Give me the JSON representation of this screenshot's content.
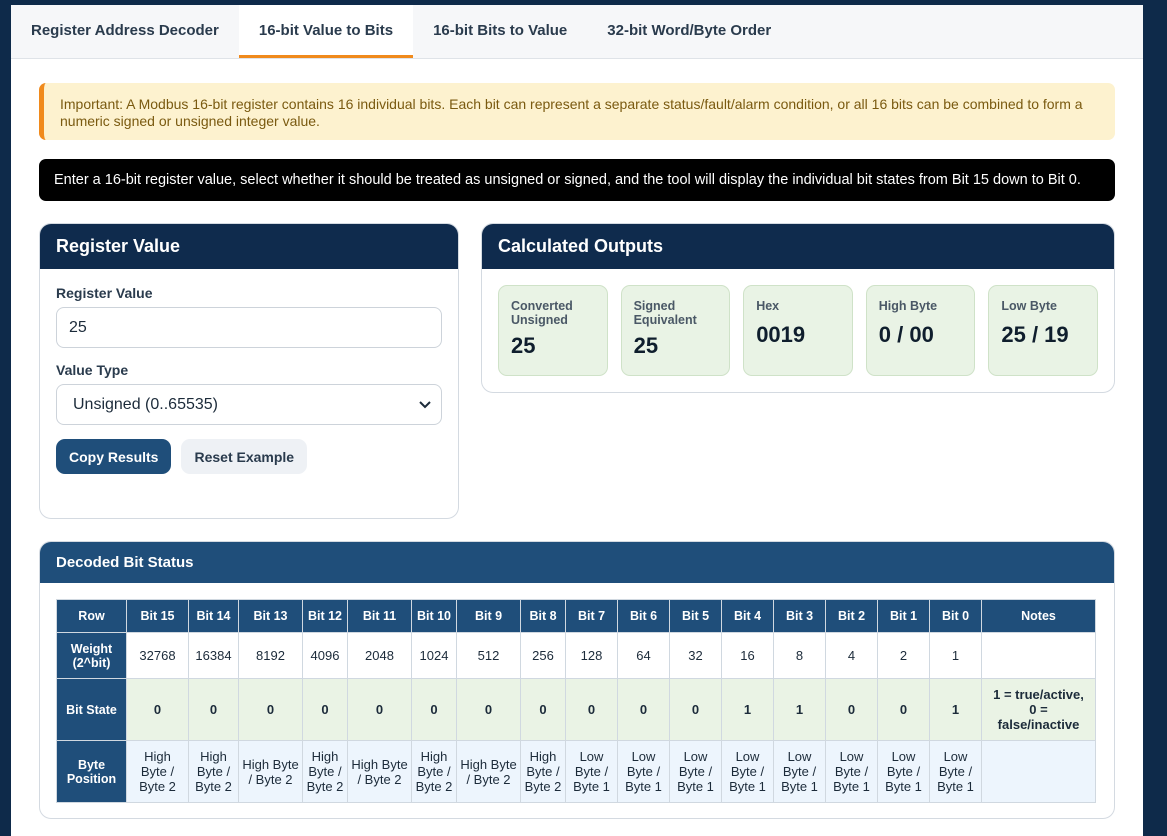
{
  "tabs": [
    {
      "label": "Register Address Decoder",
      "active": false
    },
    {
      "label": "16-bit Value to Bits",
      "active": true
    },
    {
      "label": "16-bit Bits to Value",
      "active": false
    },
    {
      "label": "32-bit Word/Byte Order",
      "active": false
    }
  ],
  "notice": "Important: A Modbus 16-bit register contains 16 individual bits. Each bit can represent a separate status/fault/alarm condition, or all 16 bits can be combined to form a numeric signed or unsigned integer value.",
  "instructions": "Enter a 16-bit register value, select whether it should be treated as unsigned or signed, and the tool will display the individual bit states from Bit 15 down to Bit 0.",
  "register_card": {
    "title": "Register Value",
    "value_label": "Register Value",
    "value": "25",
    "type_label": "Value Type",
    "type_selected": "Unsigned (0..65535)",
    "copy_button": "Copy Results",
    "reset_button": "Reset Example"
  },
  "outputs_card": {
    "title": "Calculated Outputs",
    "items": [
      {
        "label": "Converted Unsigned",
        "value": "25"
      },
      {
        "label": "Signed Equivalent",
        "value": "25"
      },
      {
        "label": "Hex",
        "value": "0019"
      },
      {
        "label": "High Byte",
        "value": "0 / 00"
      },
      {
        "label": "Low Byte",
        "value": "25 / 19"
      }
    ]
  },
  "bits_card": {
    "title": "Decoded Bit Status",
    "headers": [
      "Row",
      "Bit 15",
      "Bit 14",
      "Bit 13",
      "Bit 12",
      "Bit 11",
      "Bit 10",
      "Bit 9",
      "Bit 8",
      "Bit 7",
      "Bit 6",
      "Bit 5",
      "Bit 4",
      "Bit 3",
      "Bit 2",
      "Bit 1",
      "Bit 0",
      "Notes"
    ],
    "rows": [
      {
        "label": "Weight (2^bit)",
        "cls": "weight",
        "cells": [
          "32768",
          "16384",
          "8192",
          "4096",
          "2048",
          "1024",
          "512",
          "256",
          "128",
          "64",
          "32",
          "16",
          "8",
          "4",
          "2",
          "1"
        ],
        "note": ""
      },
      {
        "label": "Bit State",
        "cls": "state",
        "cells": [
          "0",
          "0",
          "0",
          "0",
          "0",
          "0",
          "0",
          "0",
          "0",
          "0",
          "0",
          "1",
          "1",
          "0",
          "0",
          "1"
        ],
        "note": "1 = true/active, 0 = false/inactive"
      },
      {
        "label": "Byte Position",
        "cls": "byte",
        "cells": [
          "High Byte / Byte 2",
          "High Byte / Byte 2",
          "High Byte / Byte 2",
          "High Byte / Byte 2",
          "High Byte / Byte 2",
          "High Byte / Byte 2",
          "High Byte / Byte 2",
          "High Byte / Byte 2",
          "Low Byte / Byte 1",
          "Low Byte / Byte 1",
          "Low Byte / Byte 1",
          "Low Byte / Byte 1",
          "Low Byte / Byte 1",
          "Low Byte / Byte 1",
          "Low Byte / Byte 1",
          "Low Byte / Byte 1"
        ],
        "note": ""
      }
    ]
  }
}
